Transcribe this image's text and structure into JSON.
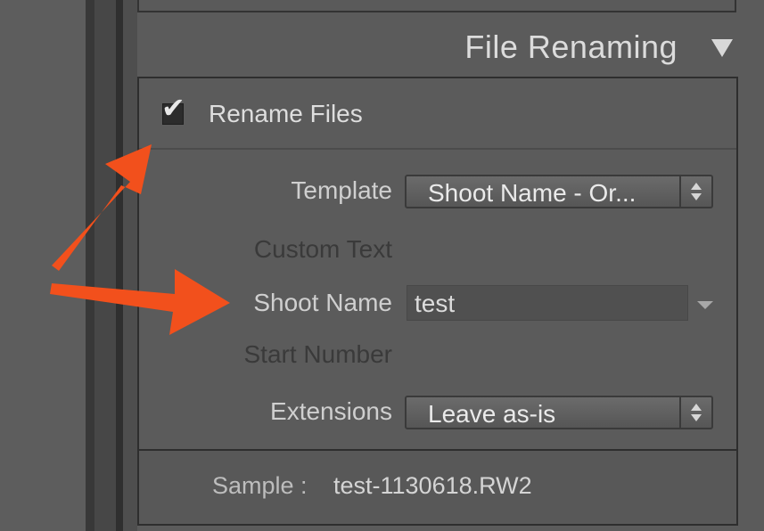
{
  "header": {
    "title": "File Renaming",
    "toggle_icon": "triangle-down-icon"
  },
  "rename": {
    "checked": true,
    "label": "Rename Files"
  },
  "fields": {
    "template": {
      "label": "Template",
      "value": "Shoot Name - Or..."
    },
    "custom_text": {
      "label": "Custom Text"
    },
    "shoot_name": {
      "label": "Shoot Name",
      "value": "test"
    },
    "start_number": {
      "label": "Start Number"
    },
    "extensions": {
      "label": "Extensions",
      "value": "Leave as-is"
    }
  },
  "sample": {
    "label": "Sample :",
    "value": "test-1130618.RW2"
  },
  "colors": {
    "annotation_arrow": "#f2501c",
    "panel_bg": "#5b5b5b",
    "text_light": "#dcdcdc"
  }
}
